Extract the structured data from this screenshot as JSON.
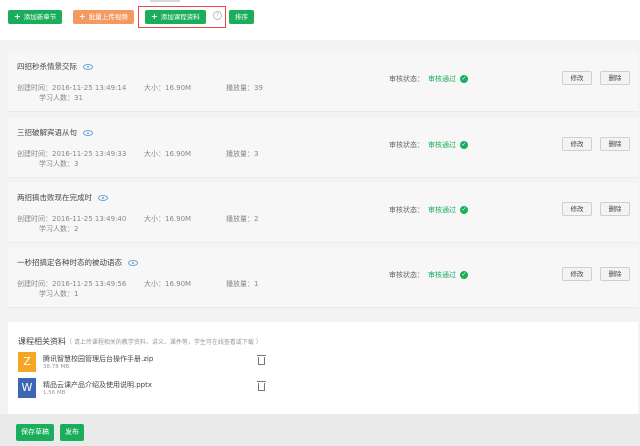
{
  "toolbar": {
    "add_section": "添加新章节",
    "batch_upload": "批量上传视频",
    "add_material": "添加课程资料",
    "sort": "排序",
    "help": "?"
  },
  "labels": {
    "created": "创建时间：",
    "size": "大小：",
    "plays": "播放量：",
    "learners": "学习人数：",
    "audit": "审核状态：",
    "edit": "修改",
    "delete": "删除"
  },
  "lessons": [
    {
      "title": "四招秒杀情景交际",
      "created": "2016-11-25 13:49:14",
      "size": "16.90M",
      "plays": "39",
      "learners": "31",
      "status": "审核通过"
    },
    {
      "title": "三招破解宾语从句",
      "created": "2016-11-25 13:49:33",
      "size": "16.90M",
      "plays": "3",
      "learners": "3",
      "status": "审核通过"
    },
    {
      "title": "两招搞击败现在完成时",
      "created": "2016-11-25 13:49:40",
      "size": "16.90M",
      "plays": "2",
      "learners": "2",
      "status": "审核通过"
    },
    {
      "title": "一秒招搞定各种时态的被动语态",
      "created": "2016-11-25 13:49:56",
      "size": "16.90M",
      "plays": "1",
      "learners": "1",
      "status": "审核通过"
    }
  ],
  "materials": {
    "title": "课程相关资料",
    "hint": "（ 请上传课程相关的教学资料、讲义、课件等，学生可在线查看或下载 ）",
    "files": [
      {
        "icon": "Z",
        "color": "#f5a623",
        "name": "腾讯智慧校园管理后台操作手册.zip",
        "size": "38.78 MB"
      },
      {
        "icon": "W",
        "color": "#3e67b3",
        "name": "精品云课产品介绍及使用说明.pptx",
        "size": "1.56 MB"
      }
    ]
  },
  "footer": {
    "save_draft": "保存草稿",
    "publish": "发布"
  }
}
